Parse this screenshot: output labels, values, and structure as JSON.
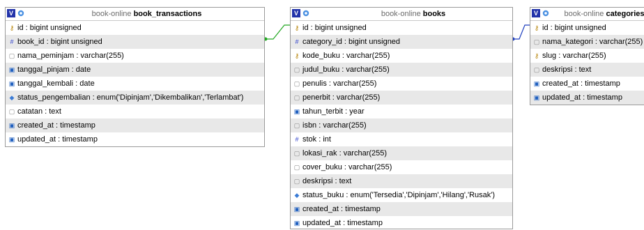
{
  "tables": {
    "book_transactions": {
      "db": "book-online",
      "name": "book_transactions",
      "columns": [
        {
          "text": "id : bigint unsigned",
          "icon": "key-icon"
        },
        {
          "text": "book_id : bigint unsigned",
          "icon": "foreign-key-icon"
        },
        {
          "text": "nama_peminjam : varchar(255)",
          "icon": "text-field-icon"
        },
        {
          "text": "tanggal_pinjam : date",
          "icon": "date-field-icon"
        },
        {
          "text": "tanggal_kembali : date",
          "icon": "date-field-icon"
        },
        {
          "text": "status_pengembalian : enum('Dipinjam','Dikembalikan','Terlambat')",
          "icon": "enum-field-icon"
        },
        {
          "text": "catatan : text",
          "icon": "text-field-icon"
        },
        {
          "text": "created_at : timestamp",
          "icon": "date-field-icon"
        },
        {
          "text": "updated_at : timestamp",
          "icon": "date-field-icon"
        }
      ]
    },
    "books": {
      "db": "book-online",
      "name": "books",
      "columns": [
        {
          "text": "id : bigint unsigned",
          "icon": "key-icon"
        },
        {
          "text": "category_id : bigint unsigned",
          "icon": "foreign-key-icon"
        },
        {
          "text": "kode_buku : varchar(255)",
          "icon": "key-icon"
        },
        {
          "text": "judul_buku : varchar(255)",
          "icon": "text-field-icon"
        },
        {
          "text": "penulis : varchar(255)",
          "icon": "text-field-icon"
        },
        {
          "text": "penerbit : varchar(255)",
          "icon": "text-field-icon"
        },
        {
          "text": "tahun_terbit : year",
          "icon": "date-field-icon"
        },
        {
          "text": "isbn : varchar(255)",
          "icon": "text-field-icon"
        },
        {
          "text": "stok : int",
          "icon": "number-field-icon"
        },
        {
          "text": "lokasi_rak : varchar(255)",
          "icon": "text-field-icon"
        },
        {
          "text": "cover_buku : varchar(255)",
          "icon": "text-field-icon"
        },
        {
          "text": "deskripsi : text",
          "icon": "text-field-icon"
        },
        {
          "text": "status_buku : enum('Tersedia','Dipinjam','Hilang','Rusak')",
          "icon": "enum-field-icon"
        },
        {
          "text": "created_at : timestamp",
          "icon": "date-field-icon"
        },
        {
          "text": "updated_at : timestamp",
          "icon": "date-field-icon"
        }
      ]
    },
    "categories": {
      "db": "book-online",
      "name": "categories",
      "columns": [
        {
          "text": "id : bigint unsigned",
          "icon": "key-icon"
        },
        {
          "text": "nama_kategori : varchar(255)",
          "icon": "text-field-icon"
        },
        {
          "text": "slug : varchar(255)",
          "icon": "key-icon"
        },
        {
          "text": "deskripsi : text",
          "icon": "text-field-icon"
        },
        {
          "text": "created_at : timestamp",
          "icon": "date-field-icon"
        },
        {
          "text": "updated_at : timestamp",
          "icon": "date-field-icon"
        }
      ]
    }
  },
  "header_toggle_glyph": "V",
  "relations": [
    {
      "from": "book_transactions.book_id",
      "to": "books.id",
      "color": "#22a822"
    },
    {
      "from": "books.category_id",
      "to": "categories.id",
      "color": "#1f3fbf"
    }
  ]
}
